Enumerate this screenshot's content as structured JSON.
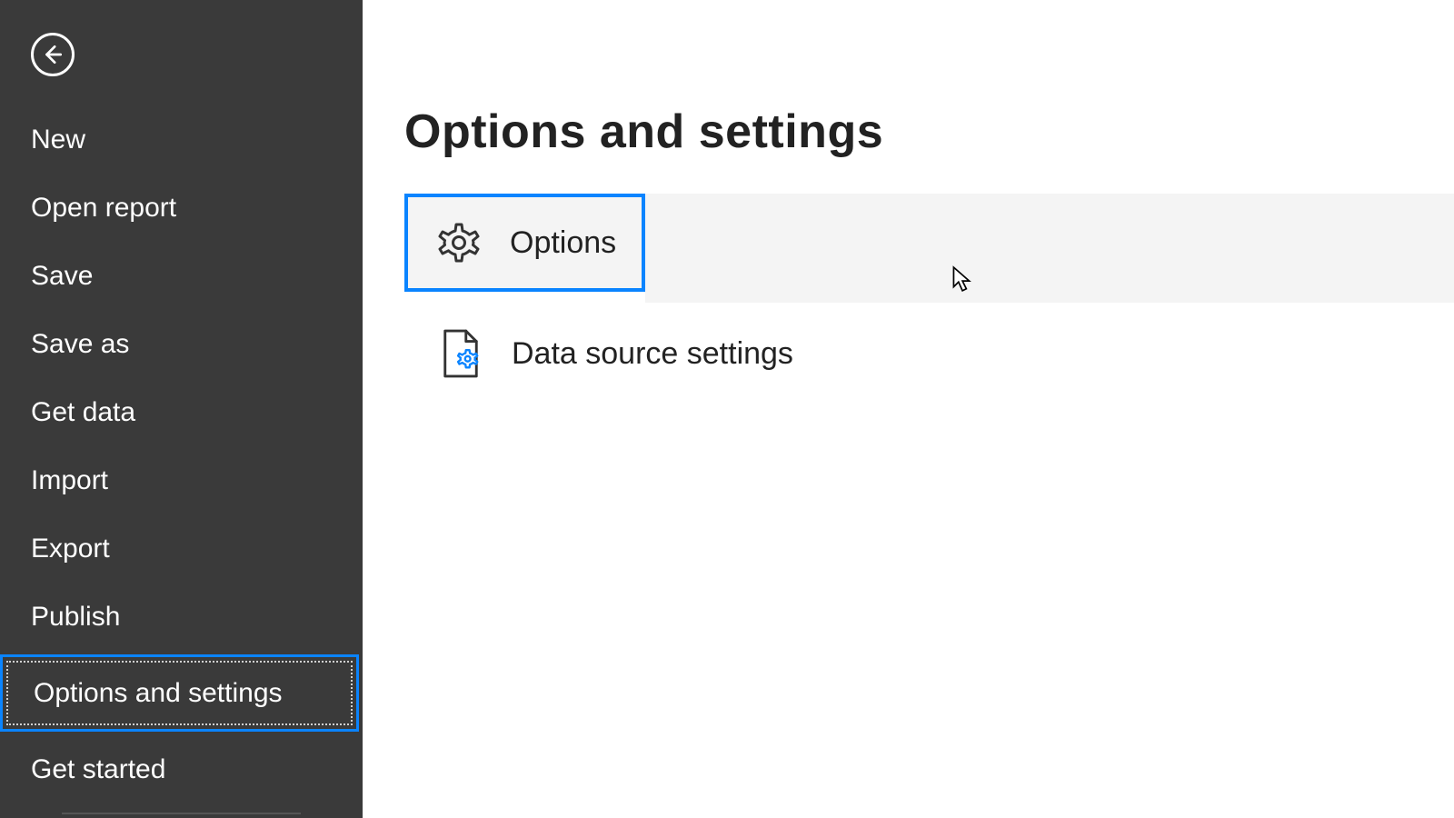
{
  "sidebar": {
    "items": [
      {
        "label": "New"
      },
      {
        "label": "Open report"
      },
      {
        "label": "Save"
      },
      {
        "label": "Save as"
      },
      {
        "label": "Get data"
      },
      {
        "label": "Import"
      },
      {
        "label": "Export"
      },
      {
        "label": "Publish"
      },
      {
        "label": "Options and settings"
      },
      {
        "label": "Get started"
      }
    ]
  },
  "main": {
    "title": "Options and settings",
    "options_label": "Options",
    "data_source_label": "Data source settings"
  }
}
